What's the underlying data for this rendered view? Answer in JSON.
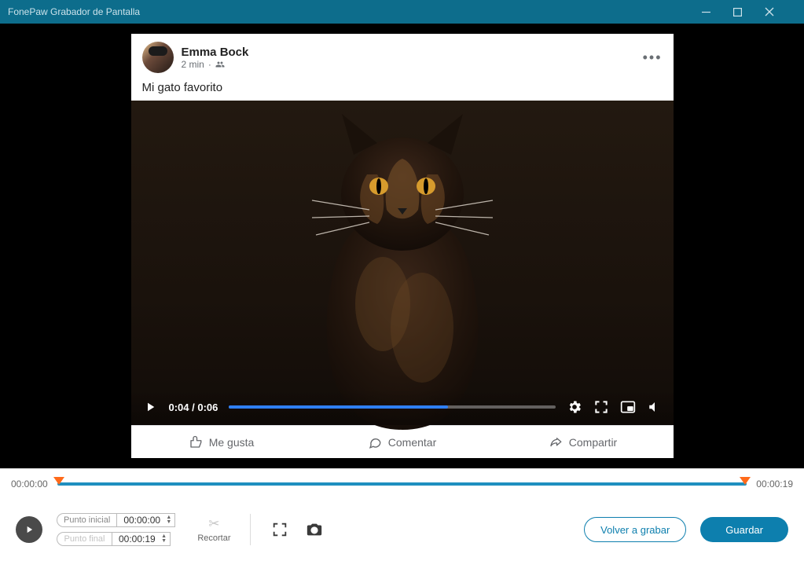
{
  "title": "FonePaw Grabador de Pantalla",
  "post": {
    "author": "Emma Bock",
    "age": "2 min",
    "caption": "Mi gato favorito",
    "like": "Me gusta",
    "comment": "Comentar",
    "share": "Compartir",
    "time_label": "0:04 / 0:06"
  },
  "timeline": {
    "start": "00:00:00",
    "end": "00:00:19"
  },
  "trim": {
    "start_label": "Punto inicial",
    "end_label": "Punto final",
    "start_val": "00:00:00",
    "end_val": "00:00:19",
    "cut_label": "Recortar"
  },
  "buttons": {
    "re_record": "Volver a grabar",
    "save": "Guardar"
  }
}
